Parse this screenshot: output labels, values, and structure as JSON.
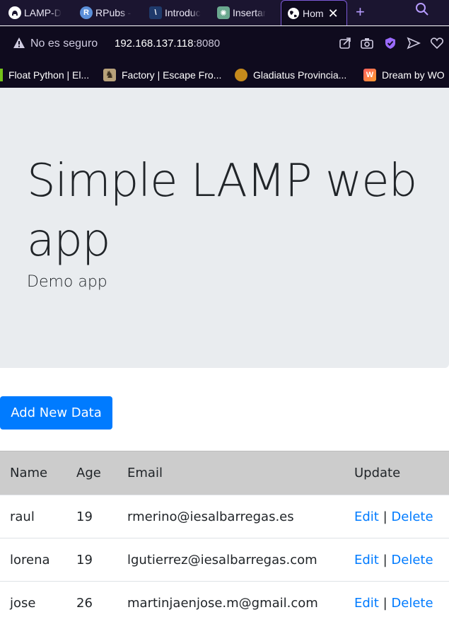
{
  "browser": {
    "tabs": [
      {
        "title": "LAMP-D",
        "icon": "github-icon"
      },
      {
        "title": "RPubs -",
        "icon": "rpubs-icon"
      },
      {
        "title": "Introduc",
        "icon": "backslash-icon"
      },
      {
        "title": "Insertar",
        "icon": "openai-icon"
      },
      {
        "title": "Hom",
        "icon": "globe-icon",
        "active": true
      }
    ],
    "security_label": "No es seguro",
    "url_host": "192.168.137.118",
    "url_port": ":8080",
    "bookmarks": [
      {
        "title": "Float Python | El...",
        "icon": "green-bar-icon"
      },
      {
        "title": "Factory | Escape Fro...",
        "icon": "chess-knight-icon"
      },
      {
        "title": "Gladiatus Provincia...",
        "icon": "gladiator-icon"
      },
      {
        "title": "Dream by WO",
        "icon": "dream-w-icon"
      }
    ]
  },
  "page": {
    "title": "Simple LAMP web app",
    "lead": "Demo app",
    "add_button": "Add New Data",
    "table": {
      "headers": {
        "name": "Name",
        "age": "Age",
        "email": "Email",
        "update": "Update"
      },
      "rows": [
        {
          "name": "raul",
          "age": "19",
          "email": "rmerino@iesalbarregas.es"
        },
        {
          "name": "lorena",
          "age": "19",
          "email": "lgutierrez@iesalbarregas.com"
        },
        {
          "name": "jose",
          "age": "26",
          "email": "martinjaenjose.m@gmail.com"
        }
      ],
      "edit_label": "Edit",
      "separator": "|",
      "delete_label": "Delete"
    }
  },
  "colors": {
    "accent": "#007bff",
    "jumbotron": "#e9ecef",
    "table_header": "#cccccc",
    "browser_chrome": "#1b1530"
  }
}
